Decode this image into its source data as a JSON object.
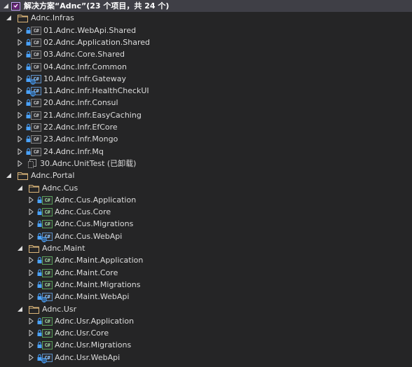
{
  "solution": {
    "title": "解决方案“Adnc”(23 个项目，共 24 个)"
  },
  "tree": [
    {
      "id": "infras",
      "label": "Adnc.Infras",
      "kind": "folder",
      "expanded": true
    },
    {
      "id": "p01",
      "label": "01.Adnc.WebApi.Shared",
      "kind": "cs"
    },
    {
      "id": "p02",
      "label": "02.Adnc.Application.Shared",
      "kind": "cs"
    },
    {
      "id": "p03",
      "label": "03.Adnc.Core.Shared",
      "kind": "cs"
    },
    {
      "id": "p04",
      "label": "04.Adnc.Infr.Common",
      "kind": "cs"
    },
    {
      "id": "p10",
      "label": "10.Adnc.Infr.Gateway",
      "kind": "web"
    },
    {
      "id": "p11",
      "label": "11.Adnc.Infr.HealthCheckUI",
      "kind": "web"
    },
    {
      "id": "p20",
      "label": "20.Adnc.Infr.Consul",
      "kind": "cs"
    },
    {
      "id": "p21",
      "label": "21.Adnc.Infr.EasyCaching",
      "kind": "cs"
    },
    {
      "id": "p22",
      "label": "22.Adnc.Infr.EfCore",
      "kind": "cs"
    },
    {
      "id": "p23",
      "label": "23.Adnc.Infr.Mongo",
      "kind": "cs"
    },
    {
      "id": "p24",
      "label": "24.Adnc.Infr.Mq",
      "kind": "cs"
    },
    {
      "id": "p30",
      "label": "30.Adnc.UnitTest (已卸载)",
      "kind": "unloaded"
    },
    {
      "id": "portal",
      "label": "Adnc.Portal",
      "kind": "folder",
      "expanded": true
    },
    {
      "id": "cus",
      "label": "Adnc.Cus",
      "kind": "folder",
      "expanded": true
    },
    {
      "id": "cus-app",
      "label": "Adnc.Cus.Application",
      "kind": "cs-green"
    },
    {
      "id": "cus-core",
      "label": "Adnc.Cus.Core",
      "kind": "cs-green"
    },
    {
      "id": "cus-mig",
      "label": "Adnc.Cus.Migrations",
      "kind": "cs-green"
    },
    {
      "id": "cus-web",
      "label": "Adnc.Cus.WebApi",
      "kind": "web"
    },
    {
      "id": "maint",
      "label": "Adnc.Maint",
      "kind": "folder",
      "expanded": true
    },
    {
      "id": "maint-app",
      "label": "Adnc.Maint.Application",
      "kind": "cs-green"
    },
    {
      "id": "maint-core",
      "label": "Adnc.Maint.Core",
      "kind": "cs-green"
    },
    {
      "id": "maint-mig",
      "label": "Adnc.Maint.Migrations",
      "kind": "cs-green"
    },
    {
      "id": "maint-web",
      "label": "Adnc.Maint.WebApi",
      "kind": "web"
    },
    {
      "id": "usr",
      "label": "Adnc.Usr",
      "kind": "folder",
      "expanded": true
    },
    {
      "id": "usr-app",
      "label": "Adnc.Usr.Application",
      "kind": "cs-green"
    },
    {
      "id": "usr-core",
      "label": "Adnc.Usr.Core",
      "kind": "cs-green"
    },
    {
      "id": "usr-mig",
      "label": "Adnc.Usr.Migrations",
      "kind": "cs-green"
    },
    {
      "id": "usr-web",
      "label": "Adnc.Usr.WebApi",
      "kind": "web"
    }
  ],
  "colors": {
    "background": "#252526",
    "selected_row": "#3f3f46",
    "text": "#dcdcdc",
    "folder": "#dcb67a",
    "lock": "#4aa3ff"
  },
  "icons": {
    "expand": "triangle-right-icon",
    "collapse": "triangle-down-icon",
    "folder": "folder-icon",
    "lock": "lock-icon",
    "csharp_project": "csharp-project-icon",
    "web_project": "web-project-icon",
    "unloaded_project": "unloaded-project-icon",
    "solution": "solution-icon"
  }
}
